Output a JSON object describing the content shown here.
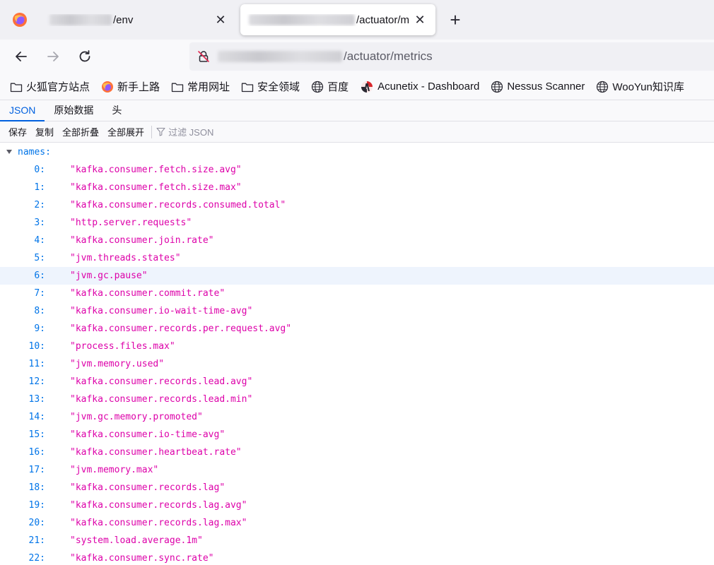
{
  "tabs": [
    {
      "title_suffix": "/env",
      "close_label": "✕",
      "active": false
    },
    {
      "title_suffix": "/actuator/m",
      "close_label": "✕",
      "active": true
    }
  ],
  "new_tab_label": "+",
  "url": {
    "path": "/actuator/metrics"
  },
  "bookmarks": [
    {
      "label": "火狐官方站点",
      "icon": "folder-icon"
    },
    {
      "label": "新手上路",
      "icon": "firefox-icon"
    },
    {
      "label": "常用网址",
      "icon": "folder-icon"
    },
    {
      "label": "安全领域",
      "icon": "folder-icon"
    },
    {
      "label": "百度",
      "icon": "globe-icon"
    },
    {
      "label": "Acunetix - Dashboard",
      "icon": "acunetix-icon"
    },
    {
      "label": "Nessus Scanner",
      "icon": "globe-icon"
    },
    {
      "label": "WooYun知识库",
      "icon": "globe-icon"
    }
  ],
  "viewer_tabs": [
    {
      "label": "JSON",
      "active": true
    },
    {
      "label": "原始数据",
      "active": false
    },
    {
      "label": "头",
      "active": false
    }
  ],
  "toolbar": {
    "save": "保存",
    "copy": "复制",
    "collapse_all": "全部折叠",
    "expand_all": "全部展开",
    "filter_placeholder": "过滤 JSON"
  },
  "json": {
    "root_key": "names:",
    "highlighted_index": 6,
    "items": [
      {
        "index": "0:",
        "value": "\"kafka.consumer.fetch.size.avg\""
      },
      {
        "index": "1:",
        "value": "\"kafka.consumer.fetch.size.max\""
      },
      {
        "index": "2:",
        "value": "\"kafka.consumer.records.consumed.total\""
      },
      {
        "index": "3:",
        "value": "\"http.server.requests\""
      },
      {
        "index": "4:",
        "value": "\"kafka.consumer.join.rate\""
      },
      {
        "index": "5:",
        "value": "\"jvm.threads.states\""
      },
      {
        "index": "6:",
        "value": "\"jvm.gc.pause\""
      },
      {
        "index": "7:",
        "value": "\"kafka.consumer.commit.rate\""
      },
      {
        "index": "8:",
        "value": "\"kafka.consumer.io-wait-time-avg\""
      },
      {
        "index": "9:",
        "value": "\"kafka.consumer.records.per.request.avg\""
      },
      {
        "index": "10:",
        "value": "\"process.files.max\""
      },
      {
        "index": "11:",
        "value": "\"jvm.memory.used\""
      },
      {
        "index": "12:",
        "value": "\"kafka.consumer.records.lead.avg\""
      },
      {
        "index": "13:",
        "value": "\"kafka.consumer.records.lead.min\""
      },
      {
        "index": "14:",
        "value": "\"jvm.gc.memory.promoted\""
      },
      {
        "index": "15:",
        "value": "\"kafka.consumer.io-time-avg\""
      },
      {
        "index": "16:",
        "value": "\"kafka.consumer.heartbeat.rate\""
      },
      {
        "index": "17:",
        "value": "\"jvm.memory.max\""
      },
      {
        "index": "18:",
        "value": "\"kafka.consumer.records.lag\""
      },
      {
        "index": "19:",
        "value": "\"kafka.consumer.records.lag.avg\""
      },
      {
        "index": "20:",
        "value": "\"kafka.consumer.records.lag.max\""
      },
      {
        "index": "21:",
        "value": "\"system.load.average.1m\""
      },
      {
        "index": "22:",
        "value": "\"kafka.consumer.sync.rate\""
      }
    ]
  }
}
